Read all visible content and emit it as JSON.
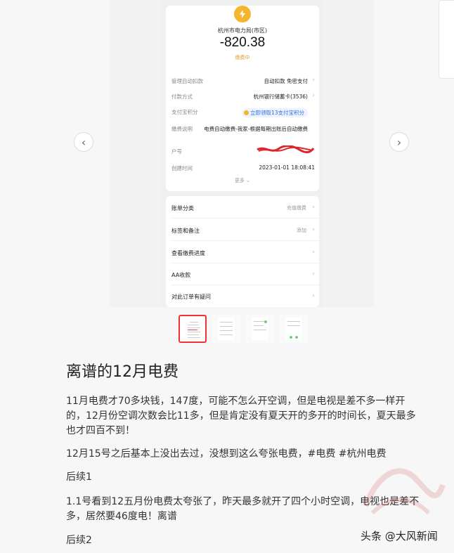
{
  "receipt": {
    "merchant": "杭州市电力局(市区)",
    "amount": "-820.38",
    "status": "缴费中",
    "details": [
      {
        "key": "管理自动扣款",
        "value": "自动扣款 免密支付"
      },
      {
        "key": "付款方式",
        "value": "杭州银行储蓄卡(3536)"
      },
      {
        "key": "支付宝积分",
        "value": "立即领取13支付宝积分"
      },
      {
        "key": "缴费说明",
        "value": "电费自动缴费-我家-根据每期出账后自动缴费"
      },
      {
        "key": "户号",
        "value": ""
      },
      {
        "key": "创建时间",
        "value": "2023-01-01 18:08:41"
      }
    ],
    "more_label": "更多",
    "menu": [
      {
        "label": "账单分类",
        "value": "充值缴费"
      },
      {
        "label": "标签和备注",
        "value": "添加"
      },
      {
        "label": "查看缴费进度",
        "value": ""
      },
      {
        "label": "AA收款",
        "value": ""
      },
      {
        "label": "对此订单有疑问",
        "value": ""
      }
    ]
  },
  "colors": {
    "accent": "#f4b62c",
    "status": "#e8a032",
    "active_thumb_border": "#ee3333"
  },
  "article": {
    "title": "离谱的12月电费",
    "paragraphs": [
      "11月电费才70多块钱，147度，可能不怎么开空调，但是电视是差不多一样开的，12月份空调次数会比11多，但是肯定没有夏天开的多开的时间长，夏天最多也才四百不到！",
      "12月15号之后基本上没出去过，没想到这么夸张电费，#电费 #杭州电费",
      "后续1",
      "1.1号看到12五月份电费太夸张了，昨天最多就开了四个小时空调，电视也是差不多，居然要46度电！离谱",
      "后续2"
    ],
    "source": "头条 @大风新闻"
  }
}
